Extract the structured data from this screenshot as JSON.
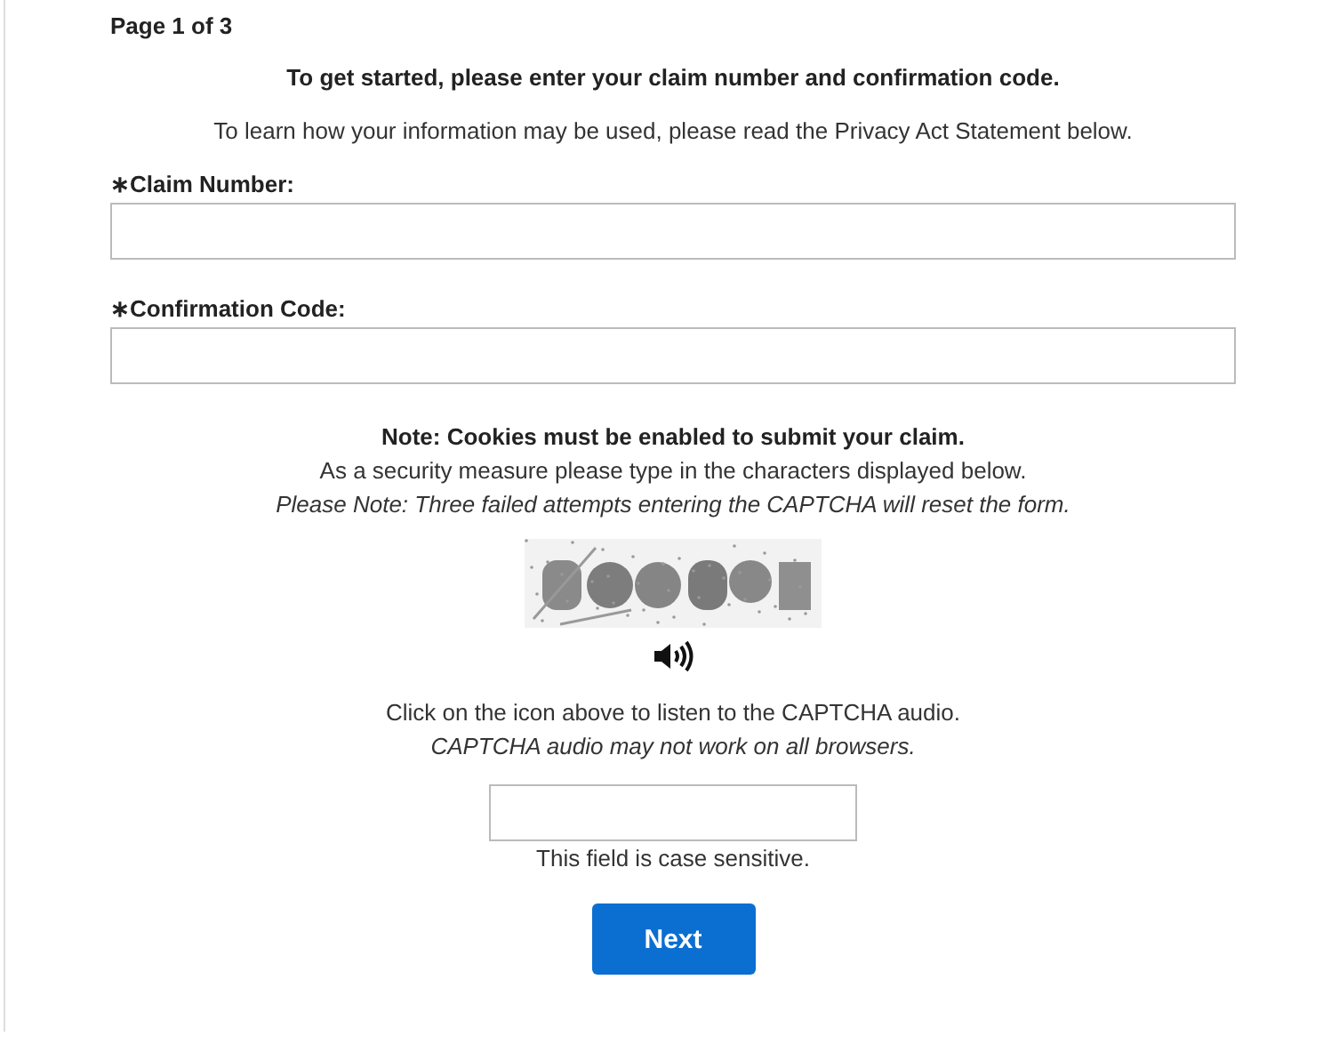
{
  "page_indicator": "Page 1 of 3",
  "intro": "To get started, please enter your claim number and confirmation code.",
  "privacy_note": "To learn how your information may be used, please read the Privacy Act Statement below.",
  "fields": [
    {
      "label": "∗Claim Number:"
    },
    {
      "label": "∗Confirmation Code:"
    }
  ],
  "cookies_note": "Note: Cookies must be enabled to submit your claim.",
  "security_note": "As a security measure please type in the characters displayed below.",
  "attempts_note": "Please Note: Three failed attempts entering the CAPTCHA will reset the form.",
  "audio_note": "Click on the icon above to listen to the CAPTCHA audio.",
  "audio_warning": "CAPTCHA audio may not work on all browsers.",
  "case_note": "This field is case sensitive.",
  "button": "Next"
}
